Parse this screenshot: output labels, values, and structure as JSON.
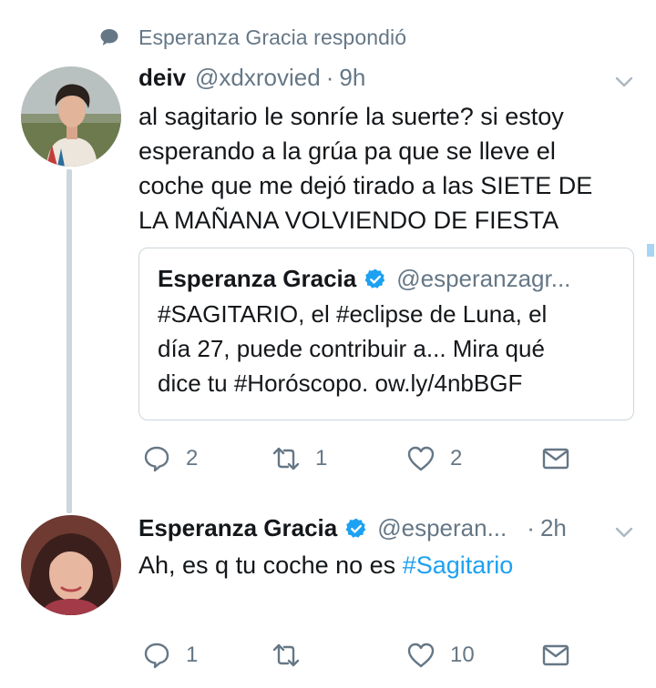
{
  "context": {
    "icon": "reply-bubble-icon",
    "text": "Esperanza Gracia respondió"
  },
  "tweet1": {
    "name": "deiv",
    "handle": "@xdxrovied",
    "separator": "·",
    "time": "9h",
    "lines": [
      "al sagitario le sonríe la suerte? si estoy",
      "esperando a la grúa pa que se lleve el",
      "coche que me dejó tirado a las SIETE DE",
      "LA MAÑANA VOLVIENDO DE FIESTA"
    ],
    "quote": {
      "name": "Esperanza Gracia",
      "handle": "@esperanzagr...",
      "lines": [
        "#SAGITARIO, el #eclipse de Luna, el",
        "día 27, puede contribuir a... Mira qué",
        "dice tu #Horóscopo. ow.ly/4nbBGF"
      ]
    },
    "actions": {
      "replies": "2",
      "retweets": "1",
      "likes": "2"
    }
  },
  "tweet2": {
    "name": "Esperanza Gracia",
    "handle": "@esperan...",
    "separator": "·",
    "time": "2h",
    "text_prefix": "Ah, es q tu coche no es ",
    "hashtag": "#Sagitario",
    "actions": {
      "replies": "1",
      "retweets": "",
      "likes": "10"
    }
  },
  "colors": {
    "link": "#1da1f2",
    "secondary": "#657786",
    "verified": "#1da1f2",
    "border": "#ccd6dd"
  }
}
